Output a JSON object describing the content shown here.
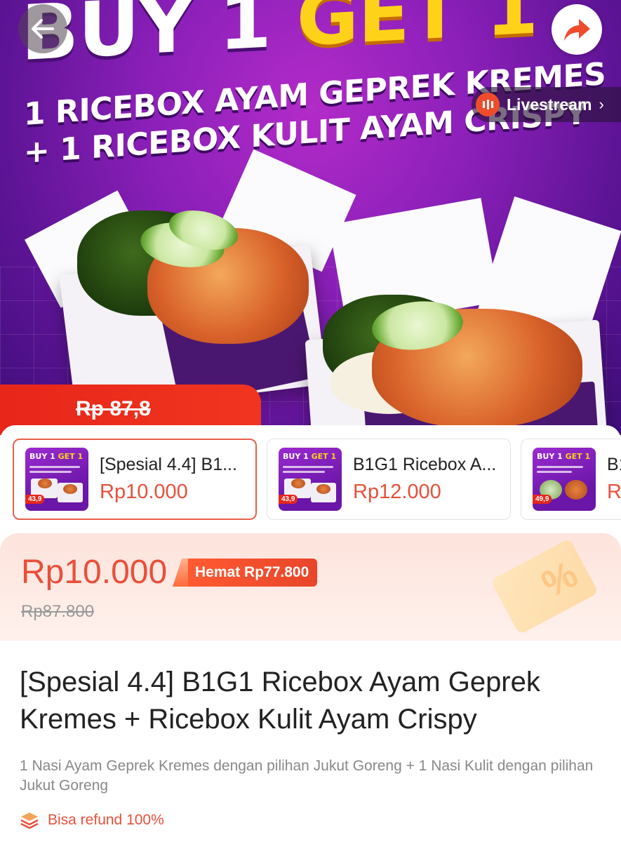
{
  "hero": {
    "headline_part1": "BUY 1 ",
    "headline_part2": "GET 1",
    "subline1": "1 RICEBOX AYAM GEPREK KREMES",
    "subline2": "+ 1 RICEBOX KULIT AYAM CRISPY",
    "strike_price": "Rp 87,8",
    "livestream_label": "Livestream"
  },
  "variants": [
    {
      "name": "[Spesial 4.4] B1...",
      "price": "Rp10.000",
      "selected": true,
      "thumb": {
        "title_a": "BUY 1 ",
        "title_b": "GET 1",
        "price": "43,9"
      }
    },
    {
      "name": "B1G1 Ricebox A...",
      "price": "Rp12.000",
      "selected": false,
      "thumb": {
        "title_a": "BUY 1 ",
        "title_b": "GET 1",
        "price": "43,9"
      }
    },
    {
      "name": "B1",
      "price": "Rp",
      "selected": false,
      "thumb": {
        "title_a": "BUY 1 ",
        "title_b": "GET 1",
        "price": "49,9"
      }
    }
  ],
  "pricing": {
    "price": "Rp10.000",
    "savings": "Hemat Rp77.800",
    "original_price": "Rp87.800"
  },
  "product": {
    "title": "[Spesial 4.4] B1G1 Ricebox Ayam Geprek Kremes + Ricebox Kulit Ayam Crispy",
    "description": "1 Nasi Ayam Geprek Kremes dengan pilihan Jukut Goreng + 1 Nasi Kulit dengan pilihan Jukut Goreng",
    "refund": "Bisa refund 100%"
  },
  "colors": {
    "accent": "#e8503a",
    "shopee_orange": "#ee4d2d",
    "hero_purple": "#8a1fb8",
    "headline_yellow": "#ffd21a"
  },
  "icons": [
    "back-arrow-icon",
    "share-icon",
    "livestream-icon",
    "chevron-right-icon",
    "refund-layers-icon",
    "coupon-icon"
  ]
}
